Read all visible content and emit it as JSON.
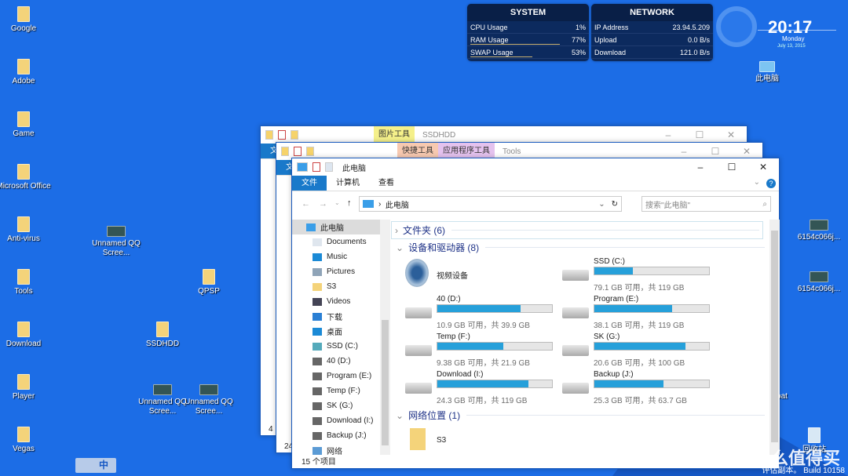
{
  "desktop": {
    "icons": [
      {
        "label": "Google",
        "kind": "folder"
      },
      {
        "label": "Adobe",
        "kind": "folder"
      },
      {
        "label": "Game",
        "kind": "folder"
      },
      {
        "label": "Microsoft Office",
        "kind": "folder"
      },
      {
        "label": "Anti-virus",
        "kind": "folder"
      },
      {
        "label": "Tools",
        "kind": "folder"
      },
      {
        "label": "Download",
        "kind": "folder"
      },
      {
        "label": "Player",
        "kind": "folder"
      },
      {
        "label": "Vegas",
        "kind": "folder"
      },
      {
        "label": "Unnamed QQ Scree...",
        "kind": "image"
      },
      {
        "label": "QPSP",
        "kind": "folder"
      },
      {
        "label": "SSDHDD",
        "kind": "folder"
      },
      {
        "label": "Unnamed QQ Scree...",
        "kind": "image"
      },
      {
        "label": "Unnamed QQ Scree...",
        "kind": "image"
      },
      {
        "label": "此电脑",
        "kind": "pc"
      },
      {
        "label": "6154c066j...",
        "kind": "image"
      },
      {
        "label": "6154c066j...",
        "kind": "image"
      },
      {
        "label": "oat",
        "kind": "text"
      },
      {
        "label": "回收站",
        "kind": "recycle"
      }
    ],
    "ime": "中",
    "watermark": "值 什么值得买",
    "build": "评估副本。 Build 10158"
  },
  "system": {
    "title": "SYSTEM",
    "rows": [
      {
        "label": "CPU Usage",
        "value": "1%",
        "pct": 1
      },
      {
        "label": "RAM Usage",
        "value": "77%",
        "pct": 77
      },
      {
        "label": "SWAP Usage",
        "value": "53%",
        "pct": 53
      }
    ]
  },
  "network": {
    "title": "NETWORK",
    "rows": [
      {
        "label": "IP Address",
        "value": "23.94.5.209"
      },
      {
        "label": "Upload",
        "value": "0.0 B/s"
      },
      {
        "label": "Download",
        "value": "121.0 B/s"
      }
    ]
  },
  "clock": {
    "time": "20:17",
    "day": "Monday",
    "date": "July 13, 2015"
  },
  "win1": {
    "context": "图片工具",
    "title": "SSDHDD",
    "ribbon_file": "文",
    "status": "4"
  },
  "win2": {
    "context1": "快捷工具",
    "context2": "应用程序工具",
    "title": "Tools",
    "ribbon_file": "文",
    "status": "24"
  },
  "main": {
    "title": "此电脑",
    "tabs": [
      "文件",
      "计算机",
      "查看"
    ],
    "address": "此电脑",
    "search_placeholder": "搜索\"此电脑\"",
    "nav": [
      "此电脑",
      "Documents",
      "Music",
      "Pictures",
      "S3",
      "Videos",
      "下载",
      "桌面",
      "SSD (C:)",
      "40 (D:)",
      "Program (E:)",
      "Temp (F:)",
      "SK (G:)",
      "Download (I:)",
      "Backup (J:)",
      "网络"
    ],
    "folders_header": "文件夹 (6)",
    "devices_header": "设备和驱动器 (8)",
    "video_device": "视频设备",
    "drives": [
      {
        "name": "SSD (C:)",
        "sub": "79.1 GB 可用，共 119 GB",
        "used": 0.335
      },
      {
        "name": "40 (D:)",
        "sub": "10.9 GB 可用，共 39.9 GB",
        "used": 0.727
      },
      {
        "name": "Program (E:)",
        "sub": "38.1 GB 可用，共 119 GB",
        "used": 0.68
      },
      {
        "name": "Temp (F:)",
        "sub": "9.38 GB 可用，共 21.9 GB",
        "used": 0.572
      },
      {
        "name": "SK (G:)",
        "sub": "20.6 GB 可用，共 100 GB",
        "used": 0.794
      },
      {
        "name": "Download (I:)",
        "sub": "24.3 GB 可用，共 119 GB",
        "used": 0.796
      },
      {
        "name": "Backup (J:)",
        "sub": "25.3 GB 可用，共 63.7 GB",
        "used": 0.603
      }
    ],
    "network_header": "网络位置 (1)",
    "network_item": "S3",
    "status": "15 个项目"
  },
  "colors": {
    "desktop": "#1c6de6",
    "accent": "#1979ca",
    "drive_bar": "#26a0da"
  }
}
